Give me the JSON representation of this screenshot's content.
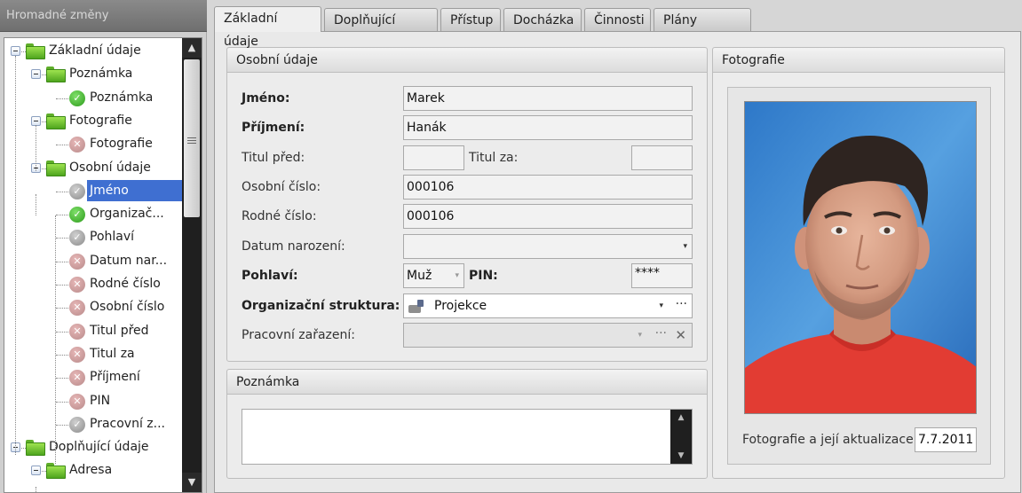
{
  "left_panel": {
    "title": "Hromadné změny",
    "tree": [
      {
        "label": "Základní údaje",
        "level": 0,
        "kind": "folder",
        "expanded": true
      },
      {
        "label": "Poznámka",
        "level": 1,
        "kind": "folder",
        "expanded": true
      },
      {
        "label": "Poznámka",
        "level": 2,
        "kind": "ok"
      },
      {
        "label": "Fotografie",
        "level": 1,
        "kind": "folder",
        "expanded": true
      },
      {
        "label": "Fotografie",
        "level": 2,
        "kind": "x"
      },
      {
        "label": "Osobní údaje",
        "level": 1,
        "kind": "folder",
        "expanded": true
      },
      {
        "label": "Jméno",
        "level": 2,
        "kind": "okgray",
        "selected": true
      },
      {
        "label": "Organizač...",
        "level": 2,
        "kind": "ok"
      },
      {
        "label": "Pohlaví",
        "level": 2,
        "kind": "okgray"
      },
      {
        "label": "Datum nar...",
        "level": 2,
        "kind": "x"
      },
      {
        "label": "Rodné číslo",
        "level": 2,
        "kind": "x"
      },
      {
        "label": "Osobní číslo",
        "level": 2,
        "kind": "x"
      },
      {
        "label": "Titul před",
        "level": 2,
        "kind": "x"
      },
      {
        "label": "Titul za",
        "level": 2,
        "kind": "x"
      },
      {
        "label": "Příjmení",
        "level": 2,
        "kind": "x"
      },
      {
        "label": "PIN",
        "level": 2,
        "kind": "x"
      },
      {
        "label": "Pracovní z...",
        "level": 2,
        "kind": "okgray"
      },
      {
        "label": "Doplňující údaje",
        "level": 0,
        "kind": "folder",
        "expanded": true
      },
      {
        "label": "Adresa",
        "level": 1,
        "kind": "folder",
        "expanded": true
      }
    ]
  },
  "tabs": [
    {
      "label": "Základní údaje",
      "active": true
    },
    {
      "label": "Doplňující údaje"
    },
    {
      "label": "Přístup"
    },
    {
      "label": "Docházka"
    },
    {
      "label": "Činnosti"
    },
    {
      "label": "Plány školení"
    }
  ],
  "personal": {
    "title": "Osobní údaje",
    "jmeno_label": "Jméno:",
    "jmeno_value": "Marek",
    "prijmeni_label": "Příjmení:",
    "prijmeni_value": "Hanák",
    "titul_pred_label": "Titul před:",
    "titul_pred_value": "",
    "titul_za_label": "Titul za:",
    "titul_za_value": "",
    "osobni_cislo_label": "Osobní číslo:",
    "osobni_cislo_value": "000106",
    "rodne_cislo_label": "Rodné číslo:",
    "rodne_cislo_value": "000106",
    "datum_label": "Datum narození:",
    "datum_value": "",
    "pohlavi_label": "Pohlaví:",
    "pohlavi_value": "Muž",
    "pin_label": "PIN:",
    "pin_value": "****",
    "org_label": "Organizační struktura:",
    "org_value": "Projekce",
    "prac_label": "Pracovní zařazení:",
    "prac_value": ""
  },
  "note": {
    "title": "Poznámka",
    "value": ""
  },
  "photo": {
    "title": "Fotografie",
    "update_label": "Fotografie a její aktualizace:",
    "update_date": "7.7.2011"
  },
  "icons": {
    "dropdown": "▾",
    "ellipsis": "···",
    "clear": "✕",
    "scroll_up": "▲",
    "scroll_down": "▼",
    "ok": "✓",
    "x": "✕"
  },
  "colors": {
    "selection": "#3f6fd1",
    "ok_green": "#2d9b1b",
    "folder_green": "#4ea51e",
    "photo_bg": "#2b73c2",
    "shirt": "#e53a32"
  }
}
